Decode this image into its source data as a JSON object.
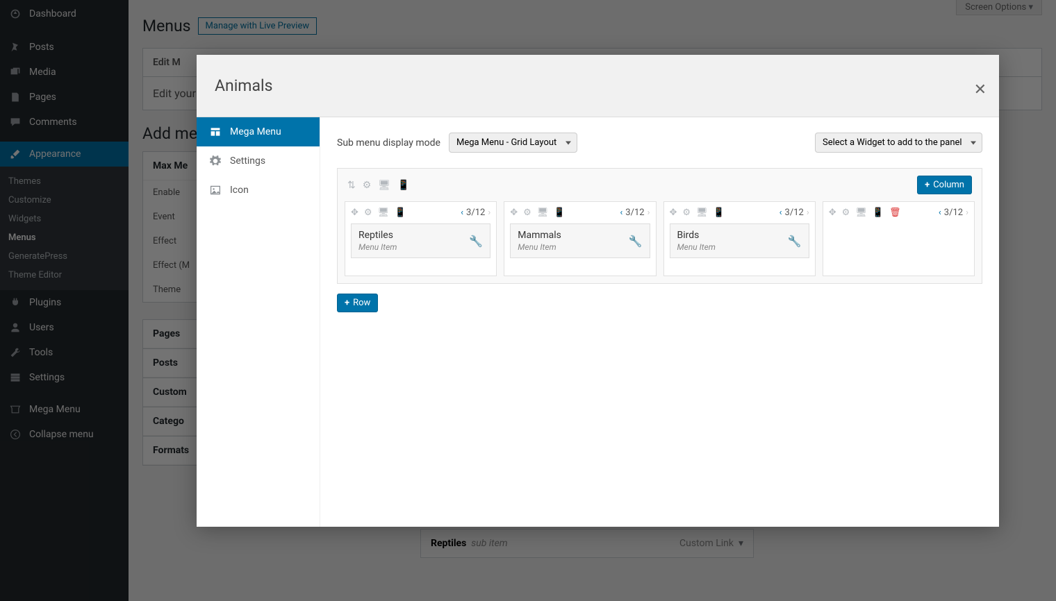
{
  "screen_options": "Screen Options",
  "sidebar": {
    "items": [
      {
        "label": "Dashboard"
      },
      {
        "label": "Posts"
      },
      {
        "label": "Media"
      },
      {
        "label": "Pages"
      },
      {
        "label": "Comments"
      },
      {
        "label": "Appearance"
      },
      {
        "label": "Plugins"
      },
      {
        "label": "Users"
      },
      {
        "label": "Tools"
      },
      {
        "label": "Settings"
      },
      {
        "label": "Mega Menu"
      },
      {
        "label": "Collapse menu"
      }
    ],
    "appearance_sub": [
      "Themes",
      "Customize",
      "Widgets",
      "Menus",
      "GeneratePress",
      "Theme Editor"
    ]
  },
  "page": {
    "title": "Menus",
    "live_preview": "Manage with Live Preview",
    "edit_menu_tab": "Edit M",
    "edit_body": "Edit your",
    "add_heading": "Add me",
    "max_heading": "Max Me",
    "opts": [
      "Enable",
      "Event",
      "Effect",
      "Effect (M",
      "Theme"
    ],
    "boxes": [
      "Pages",
      "Posts",
      "Custom",
      "Catego",
      "Formats"
    ],
    "back_item_title": "Reptiles",
    "back_item_sub": "sub item",
    "back_item_type": "Custom Link"
  },
  "modal": {
    "title": "Animals",
    "tabs": [
      "Mega Menu",
      "Settings",
      "Icon"
    ],
    "display_mode_label": "Sub menu display mode",
    "display_mode_value": "Mega Menu - Grid Layout",
    "widget_select": "Select a Widget to add to the panel",
    "add_column": "Column",
    "add_row": "Row",
    "col_size": "3/12",
    "menu_item_type": "Menu Item",
    "cols": [
      {
        "title": "Reptiles"
      },
      {
        "title": "Mammals"
      },
      {
        "title": "Birds"
      },
      {
        "title": null
      }
    ]
  }
}
